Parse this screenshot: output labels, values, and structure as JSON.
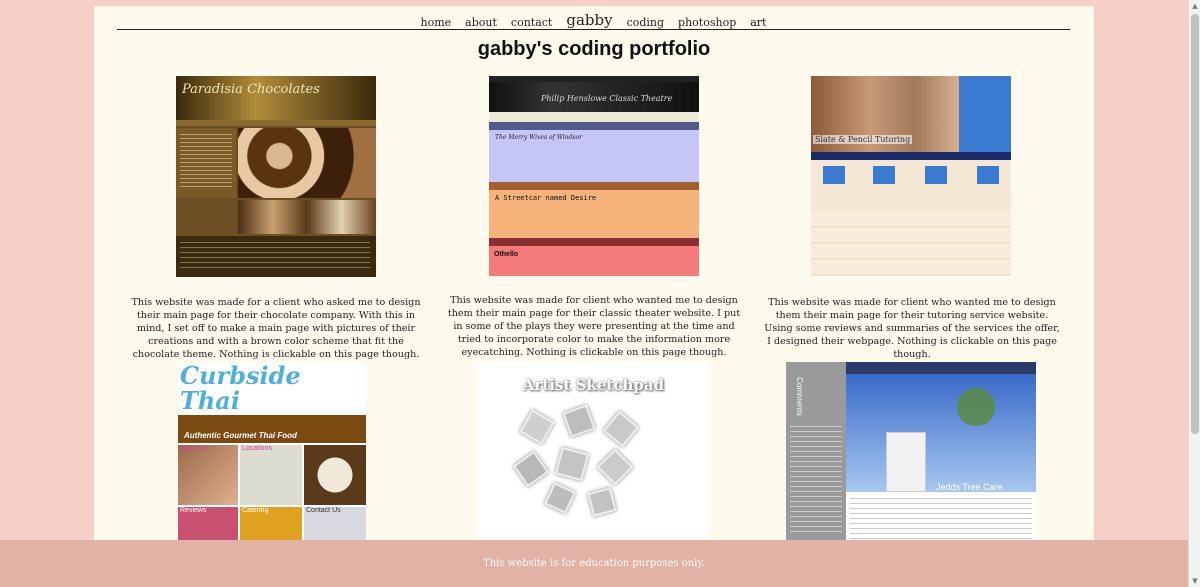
{
  "nav": {
    "home": "home",
    "about": "about",
    "contact": "contact",
    "brand": "gabby",
    "coding": "coding",
    "photoshop": "photoshop",
    "art": "art"
  },
  "page_title": "gabby's coding portfolio",
  "projects": [
    {
      "description": "This website was made for a client who asked me to design their main page for their chocolate company. With this in mind, I set off to make a main page with pictures of their creations and with a brown color scheme that fit the chocolate theme. Nothing is clickable on this page though.",
      "thumb_title": "Paradisia Chocolates"
    },
    {
      "description": "This website was made for client who wanted me to design them their main page for their classic theater website. I put in some of the plays they were presenting at the time and tried to incorporate color to make the information more eyecatching. Nothing is clickable on this page though.",
      "thumb_title": "Philip Henslowe Classic Theatre",
      "plays": [
        "The Merry Wives of Windsor",
        "A Streetcar named Desire",
        "Othello"
      ]
    },
    {
      "description": "This website was made for client who wanted me to design them their main page for their tutoring service website. Using some reviews and summaries of the services the offer, I designed their webpage. Nothing is clickable on this page though.",
      "thumb_title": "Slate & Pencil Tutoring"
    },
    {
      "thumb_title": "Curbside Thai",
      "thumb_subtitle": "Authentic Gourmet Thai Food",
      "tiles": [
        "About Us",
        "Locations",
        "Reviews",
        "Catering",
        "Contact Us"
      ]
    },
    {
      "thumb_title": "Artist Sketchpad"
    },
    {
      "thumb_title": "Jedds Tree Care",
      "side_label": "Comments"
    }
  ],
  "footer": "This website is for education purposes only.",
  "colors": {
    "background": "#f6cfc9",
    "page": "#fffaee",
    "footer": "#e2b2a6"
  }
}
